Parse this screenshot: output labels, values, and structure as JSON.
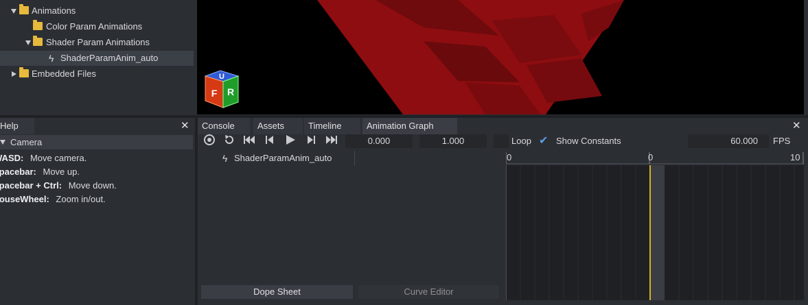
{
  "tree": {
    "items": [
      {
        "label": "Animations",
        "kind": "folder",
        "expanded": true
      },
      {
        "label": "Color Param Animations",
        "kind": "folder"
      },
      {
        "label": "Shader Param Animations",
        "kind": "folder",
        "expanded": true
      },
      {
        "label": "ShaderParamAnim_auto",
        "kind": "animation",
        "selected": true
      },
      {
        "label": "Embedded Files",
        "kind": "folder",
        "expanded": false
      }
    ]
  },
  "viewport": {
    "gizmo_labels": {
      "top": "U",
      "left": "F",
      "right": "R"
    }
  },
  "help": {
    "title": "Help",
    "section": "Camera",
    "lines": [
      {
        "key": "WASD:",
        "desc": "Move camera."
      },
      {
        "key": "Spacebar:",
        "desc": "Move up."
      },
      {
        "key": "Spacebar + Ctrl:",
        "desc": "Move down."
      },
      {
        "key": "MouseWheel:",
        "desc": "Zoom in/out."
      }
    ]
  },
  "anim": {
    "tabs": [
      "Console",
      "Assets",
      "Timeline",
      "Animation Graph"
    ],
    "active_tab": "Animation Graph",
    "start_time": "0.000",
    "end_time": "1.000",
    "loop_label": "Loop",
    "show_constants_label": "Show Constants",
    "show_constants_checked": true,
    "fps_value": "60.000",
    "fps_label": "FPS",
    "track": "ShaderParamAnim_auto",
    "ruler": {
      "left": "0",
      "mid": "0",
      "right": "10"
    },
    "bottom_tabs": {
      "dope_sheet": "Dope Sheet",
      "curve_editor": "Curve Editor"
    }
  },
  "colors": {
    "accent_playhead": "#d4b21c",
    "folder": "#e7b93c",
    "checkmark": "#5aa0e6"
  }
}
